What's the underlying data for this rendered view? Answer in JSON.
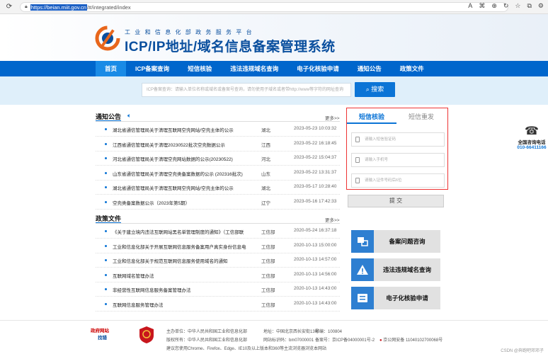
{
  "browser": {
    "url_highlight": "https://beian.miit.gov.cn",
    "url_rest": "/#/integrated/index"
  },
  "header": {
    "subtitle": "工业和信息化部政务服务平台",
    "title": "ICP/IP地址/域名信息备案管理系统"
  },
  "nav": [
    "首页",
    "ICP备案查询",
    "短信核验",
    "违法违规域名查询",
    "电子化核验申请",
    "通知公告",
    "政策文件"
  ],
  "search": {
    "placeholder": "ICP备案查询：请输入单位名称或域名或备案号查询，请勿使用子域名或者带http://www等字符的网址查询",
    "button": "搜索"
  },
  "notices": {
    "title": "通知公告",
    "more": "更多>>",
    "items": [
      {
        "t": "湖北省通信管理局关于清理互联网空壳网站/空壳主体的公示",
        "r": "湖北",
        "d": "2023-05-23 10:03:32"
      },
      {
        "t": "江西省通信管理局关于清理20230522批次空壳数据公示",
        "r": "江西",
        "d": "2023-05-22 16:18:45"
      },
      {
        "t": "河北省通信管理局关于清理空壳网站数据的公示(20230522)",
        "r": "河北",
        "d": "2023-05-22 15:04:37"
      },
      {
        "t": "山东省通信管理局关于清理空壳类备案数据的公示 (202316批次)",
        "r": "山东",
        "d": "2023-05-22 13:31:37"
      },
      {
        "t": "湖北省通信管理局关于清理互联网空壳网站/空壳主体的公示",
        "r": "湖北",
        "d": "2023-05-17 10:28:40"
      },
      {
        "t": "空壳类备案数据公示（2023年第5期）",
        "r": "辽宁",
        "d": "2023-05-16 17:42:33"
      }
    ]
  },
  "policies": {
    "title": "政策文件",
    "more": "更多>>",
    "items": [
      {
        "t": "《关于建立境内违法互联网站黑名单管理制度的通知》（工信部联",
        "r": "工信部",
        "d": "2020-05-24 16:37:18"
      },
      {
        "t": "工业和信息化部关于开展互联网信息服务备案用户真实身份信息电",
        "r": "工信部",
        "d": "2020-10-13 15:00:00"
      },
      {
        "t": "工业和信息化部关于规范互联网信息服务使用域名的通知",
        "r": "工信部",
        "d": "2020-10-13 14:57:00"
      },
      {
        "t": "互联网域名管理办法",
        "r": "工信部",
        "d": "2020-10-13 14:56:00"
      },
      {
        "t": "非经营性互联网信息服务备案管理办法",
        "r": "工信部",
        "d": "2020-10-13 14:43:00"
      },
      {
        "t": "互联网信息服务管理办法",
        "r": "工信部",
        "d": "2020-10-13 14:43:00"
      }
    ]
  },
  "login": {
    "tab1": "短信核验",
    "tab2": "短信重发",
    "f1": "请输入短信验证码",
    "f2": "请输入手机号",
    "f3": "请输入证件号码后6位",
    "submit": "提 交"
  },
  "cards": [
    "备案问题咨询",
    "违法违规域名查询",
    "电子化核验申请"
  ],
  "hotline": {
    "label": "全国咨询电话",
    "number": "010-66411166"
  },
  "footer": {
    "logo1": "政府网站",
    "logo2": "找错",
    "l1a": "主办单位：中华人民共和国工业和信息化部",
    "l1b": "地址：中国北京西长安街13号",
    "l1c": "邮编：100804",
    "l2a": "版权所有：中华人民共和国工业和信息化部",
    "l2b": "网站标识码：bm07000001",
    "l2c": "备案号：京ICP备04000001号-2",
    "l2d": "京公网安备 11040102700068号",
    "l3": "建议您使用Chrome、Firefox、Edge、IE10及以上版本和360等主流浏览器浏览本网站",
    "csdn": "CSDN @奔跑吧邓邓子"
  }
}
